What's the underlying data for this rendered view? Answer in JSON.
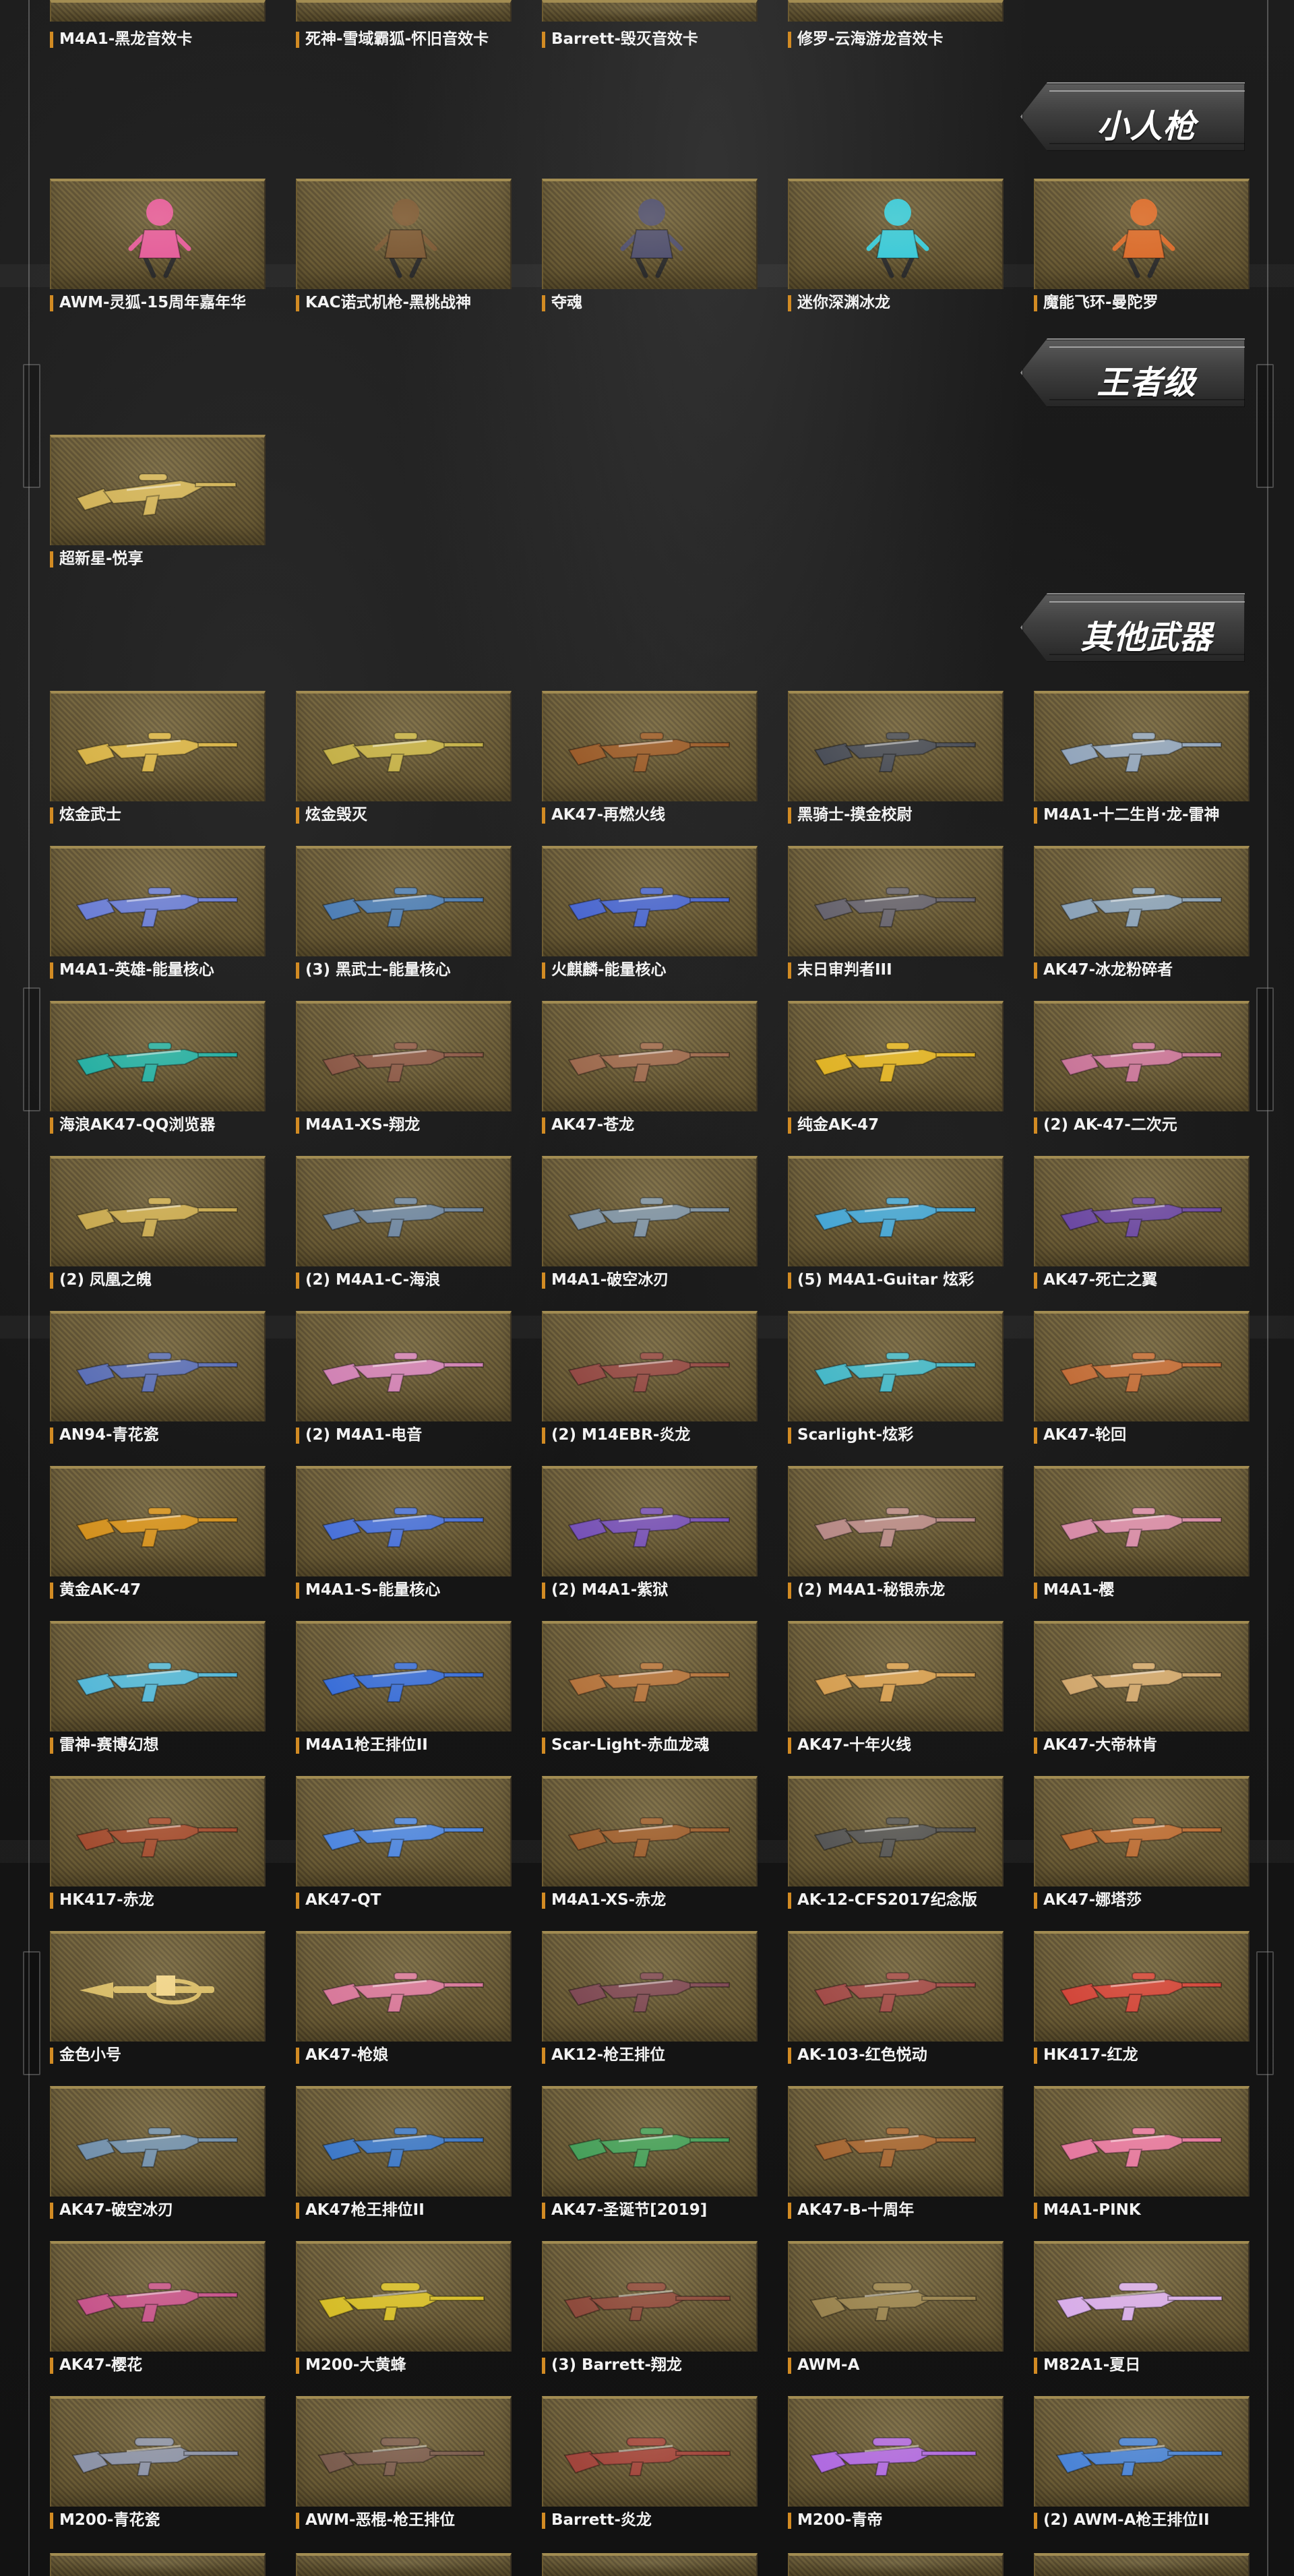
{
  "sections": {
    "chibi": {
      "title": "小人枪"
    },
    "king": {
      "title": "王者级"
    },
    "other": {
      "title": "其他武器"
    }
  },
  "top_row": [
    {
      "name": "M4A1-黑龙音效卡"
    },
    {
      "name": "死神-雪域霸狐-怀旧音效卡"
    },
    {
      "name": "Barrett-毁灭音效卡"
    },
    {
      "name": "修罗-云海游龙音效卡"
    }
  ],
  "chibi_items": [
    {
      "name": "AWM-灵狐-15周年嘉年华",
      "icon": "pink-fox-character-icon",
      "accent": "#e45c9b"
    },
    {
      "name": "KAC诺式机枪-黑桃战神",
      "icon": "soldier-character-icon",
      "accent": "#7b5835"
    },
    {
      "name": "夺魂",
      "icon": "reaper-character-icon",
      "accent": "#4f4f6f"
    },
    {
      "name": "迷你深渊冰龙",
      "icon": "ice-dragon-character-icon",
      "accent": "#39c9d9"
    },
    {
      "name": "魔能飞环-曼陀罗",
      "icon": "red-hair-character-icon",
      "accent": "#d96a2b"
    }
  ],
  "king_items": [
    {
      "name": "超新星-悦享",
      "icon": "golden-rifle-icon",
      "accent": "#d2b45b"
    }
  ],
  "other_items": [
    {
      "name": "炫金武士",
      "icon": "rifle-icon",
      "accent": "#d8b44a"
    },
    {
      "name": "炫金毁灭",
      "icon": "rifle-icon",
      "accent": "#c5b14a"
    },
    {
      "name": "AK47-再燃火线",
      "icon": "rifle-icon",
      "accent": "#9b5d2c"
    },
    {
      "name": "黑骑士-摸金校尉",
      "icon": "rifle-icon",
      "accent": "#4b4f59"
    },
    {
      "name": "M4A1-十二生肖·龙-雷神",
      "icon": "rifle-icon",
      "accent": "#93a6bd"
    },
    {
      "name": "M4A1-英雄-能量核心",
      "icon": "rifle-icon",
      "accent": "#6c7fd6"
    },
    {
      "name": "(3) 黑武士-能量核心",
      "icon": "rifle-icon",
      "accent": "#4f7fb6"
    },
    {
      "name": "火麒麟-能量核心",
      "icon": "rifle-icon",
      "accent": "#4b68d0"
    },
    {
      "name": "末日审判者III",
      "icon": "rifle-icon",
      "accent": "#67646f"
    },
    {
      "name": "AK47-冰龙粉碎者",
      "icon": "rifle-icon",
      "accent": "#8ca3b9"
    },
    {
      "name": "海浪AK47-QQ浏览器",
      "icon": "rifle-icon",
      "accent": "#29b0a4"
    },
    {
      "name": "M4A1-XS-翔龙",
      "icon": "rifle-icon",
      "accent": "#8c5a49"
    },
    {
      "name": "AK47-苍龙",
      "icon": "rifle-icon",
      "accent": "#9d6a4f"
    },
    {
      "name": "纯金AK-47",
      "icon": "rifle-icon",
      "accent": "#e0b327"
    },
    {
      "name": "(2) AK-47-二次元",
      "icon": "rifle-icon",
      "accent": "#c9769a"
    },
    {
      "name": "(2) 凤凰之魄",
      "icon": "rifle-icon",
      "accent": "#c9aa52"
    },
    {
      "name": "(2) M4A1-C-海浪",
      "icon": "rifle-icon",
      "accent": "#6f87a2"
    },
    {
      "name": "M4A1-破空冰刃",
      "icon": "rifle-icon",
      "accent": "#7f93a5"
    },
    {
      "name": "(5) M4A1-Guitar 炫彩",
      "icon": "rifle-icon",
      "accent": "#47a6d4"
    },
    {
      "name": "AK47-死亡之翼",
      "icon": "rifle-icon",
      "accent": "#6c49a3"
    },
    {
      "name": "AN94-青花瓷",
      "icon": "rifle-icon",
      "accent": "#5c70b7"
    },
    {
      "name": "(2) M4A1-电音",
      "icon": "rifle-icon",
      "accent": "#d183b5"
    },
    {
      "name": "(2) M14EBR-炎龙",
      "icon": "rifle-icon",
      "accent": "#934a45"
    },
    {
      "name": "Scarlight-炫彩",
      "icon": "rifle-icon",
      "accent": "#47b8c8"
    },
    {
      "name": "AK47-轮回",
      "icon": "rifle-icon",
      "accent": "#c26e3a"
    },
    {
      "name": "黄金AK-47",
      "icon": "rifle-icon",
      "accent": "#d3911f"
    },
    {
      "name": "M4A1-S-能量核心",
      "icon": "rifle-icon",
      "accent": "#4a72d9"
    },
    {
      "name": "(2) M4A1-紫狱",
      "icon": "rifle-icon",
      "accent": "#7752b7"
    },
    {
      "name": "(2) M4A1-秘银赤龙",
      "icon": "rifle-icon",
      "accent": "#b78a87"
    },
    {
      "name": "M4A1-樱",
      "icon": "rifle-icon",
      "accent": "#d78ca8"
    },
    {
      "name": "雷神-赛博幻想",
      "icon": "rifle-icon",
      "accent": "#56b8d8"
    },
    {
      "name": "M4A1枪王排位II",
      "icon": "rifle-icon",
      "accent": "#3b6fd8"
    },
    {
      "name": "Scar-Light-赤血龙魂",
      "icon": "rifle-icon",
      "accent": "#b4743e"
    },
    {
      "name": "AK47-十年火线",
      "icon": "rifle-icon",
      "accent": "#d59f53"
    },
    {
      "name": "AK47-大帝林肯",
      "icon": "rifle-icon",
      "accent": "#d1a86f"
    },
    {
      "name": "HK417-赤龙",
      "icon": "rifle-icon",
      "accent": "#a34d31"
    },
    {
      "name": "AK47-QT",
      "icon": "rifle-icon",
      "accent": "#4f87e0"
    },
    {
      "name": "M4A1-XS-赤龙",
      "icon": "rifle-icon",
      "accent": "#9e6031"
    },
    {
      "name": "AK-12-CFS2017纪念版",
      "icon": "rifle-icon",
      "accent": "#565656"
    },
    {
      "name": "AK47-娜塔莎",
      "icon": "rifle-icon",
      "accent": "#bb6d36"
    },
    {
      "name": "金色小号",
      "icon": "trumpet-icon",
      "accent": "#d8bc69"
    },
    {
      "name": "AK47-枪娘",
      "icon": "rifle-icon",
      "accent": "#d8799b"
    },
    {
      "name": "AK12-枪王排位",
      "icon": "rifle-icon",
      "accent": "#7f4a55"
    },
    {
      "name": "AK-103-红色悦动",
      "icon": "rifle-icon",
      "accent": "#a24c49"
    },
    {
      "name": "HK417-红龙",
      "icon": "rifle-icon",
      "accent": "#d2473b"
    },
    {
      "name": "AK47-破空冰刃",
      "icon": "rifle-icon",
      "accent": "#7391ad"
    },
    {
      "name": "AK47枪王排位II",
      "icon": "rifle-icon",
      "accent": "#3e79c8"
    },
    {
      "name": "AK47-圣诞节[2019]",
      "icon": "rifle-icon",
      "accent": "#47a05b"
    },
    {
      "name": "AK47-B-十周年",
      "icon": "rifle-icon",
      "accent": "#a46633"
    },
    {
      "name": "M4A1-PINK",
      "icon": "rifle-icon",
      "accent": "#e5799f"
    },
    {
      "name": "AK47-樱花",
      "icon": "rifle-icon",
      "accent": "#c6558b"
    },
    {
      "name": "M200-大黄蜂",
      "icon": "sniper-icon",
      "accent": "#d6bd29"
    },
    {
      "name": "(3) Barrett-翔龙",
      "icon": "sniper-icon",
      "accent": "#8e4b3d"
    },
    {
      "name": "AWM-A",
      "icon": "sniper-icon",
      "accent": "#9a8450"
    },
    {
      "name": "M82A1-夏日",
      "icon": "sniper-icon",
      "accent": "#d8aee9"
    },
    {
      "name": "M200-青花瓷",
      "icon": "sniper-icon",
      "accent": "#8c93a8"
    },
    {
      "name": "AWM-恶棍-枪王排位",
      "icon": "sniper-icon",
      "accent": "#7b5d4f"
    },
    {
      "name": "Barrett-炎龙",
      "icon": "sniper-icon",
      "accent": "#a1453c"
    },
    {
      "name": "M200-青帝",
      "icon": "sniper-icon",
      "accent": "#b06be0"
    },
    {
      "name": "(2) AWM-A枪王排位II",
      "icon": "sniper-icon",
      "accent": "#4b84d6"
    }
  ]
}
